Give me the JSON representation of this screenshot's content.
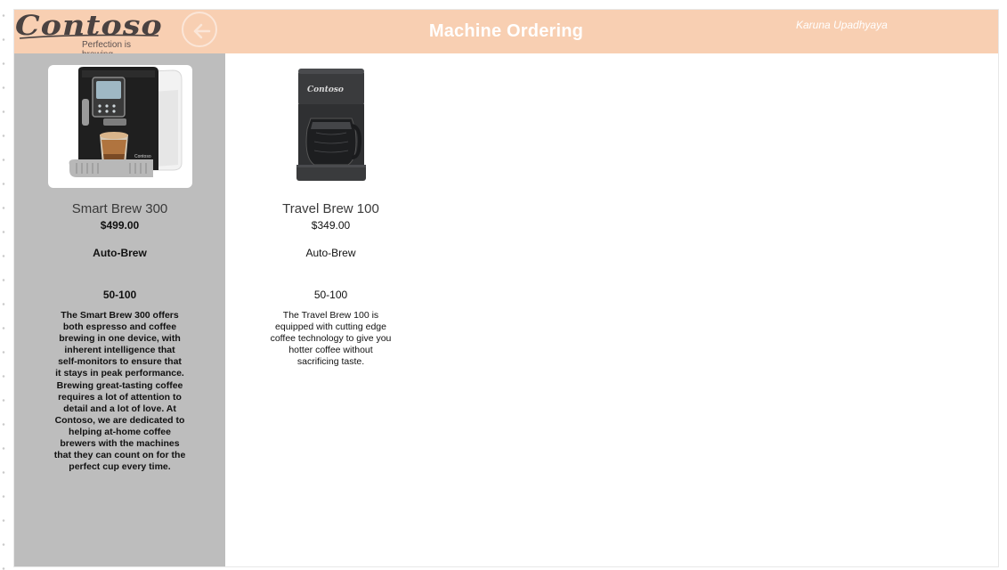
{
  "header": {
    "brand": "Contoso",
    "tagline": "Perfection is brewing.",
    "title": "Machine Ordering",
    "user": "Karuna Upadhyaya",
    "back_icon": "arrow-left-icon"
  },
  "colors": {
    "header_bg": "#f8cfb2",
    "sidebar_bg": "#bdbdbd",
    "header_text": "#ffffff"
  },
  "machines": [
    {
      "name": "Smart Brew 300",
      "price": "$499.00",
      "brew_type": "Auto-Brew",
      "capacity": "50-100",
      "description": "The Smart Brew 300 offers both espresso and coffee brewing in one device, with inherent intelligence that self-monitors to ensure that it stays in peak performance. Brewing great-tasting coffee requires a lot of attention to detail and a lot of love. At Contoso, we are dedicated to helping at-home coffee brewers with the machines that they can count on for the perfect cup every time.",
      "image_icon": "espresso-machine-image",
      "image_label": "Contoso",
      "selected": true
    },
    {
      "name": "Travel Brew 100",
      "price": "$349.00",
      "brew_type": "Auto-Brew",
      "capacity": "50-100",
      "description": "The Travel Brew 100 is equipped with cutting edge coffee technology to give you hotter coffee without sacrificing taste.",
      "image_icon": "drip-coffee-maker-image",
      "image_label": "Contoso",
      "selected": false
    }
  ]
}
